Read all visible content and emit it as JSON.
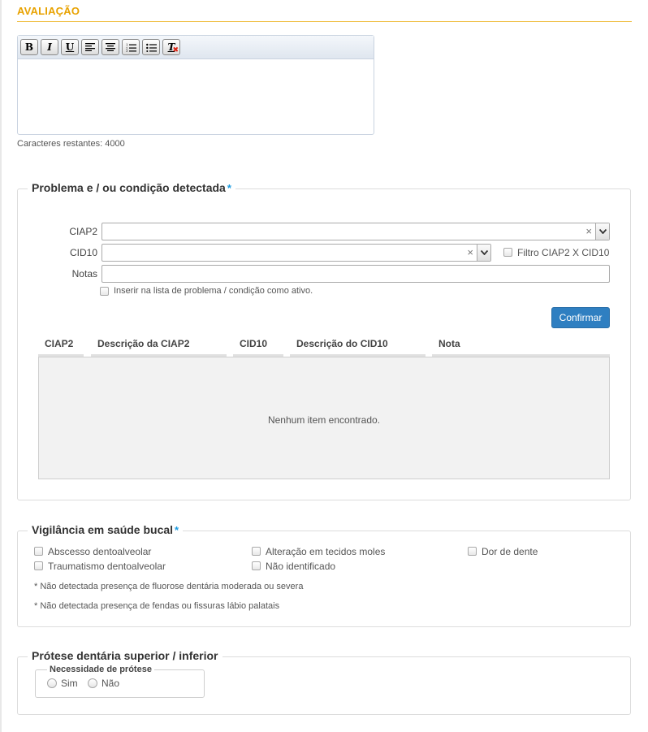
{
  "header": {
    "title": "AVALIAÇÃO"
  },
  "editor": {
    "toolbar": [
      {
        "name": "bold-button",
        "glyph": "B",
        "icon": "bold-icon"
      },
      {
        "name": "italic-button",
        "glyph": "I",
        "icon": "italic-icon"
      },
      {
        "name": "underline-button",
        "glyph": "U",
        "icon": "underline-icon"
      },
      {
        "name": "align-left-button",
        "icon": "align-left-icon"
      },
      {
        "name": "align-center-button",
        "icon": "align-center-icon"
      },
      {
        "name": "ordered-list-button",
        "icon": "ordered-list-icon"
      },
      {
        "name": "bullet-list-button",
        "icon": "bullet-list-icon"
      },
      {
        "name": "clear-format-button",
        "glyph": "T",
        "icon": "clear-format-icon"
      }
    ],
    "value": "",
    "remaining_chars": "Caracteres restantes: 4000"
  },
  "problema": {
    "legend": "Problema e / ou condição detectada",
    "required_mark": "*",
    "ciap2_label": "CIAP2",
    "cid10_label": "CID10",
    "notas_label": "Notas",
    "filtro_label": "Filtro CIAP2 X CID10",
    "inserir_label": "Inserir na lista de problema / condição como ativo.",
    "confirm_label": "Confirmar",
    "clear_glyph": "×",
    "columns": [
      "CIAP2",
      "Descrição da CIAP2",
      "CID10",
      "Descrição do CID10",
      "Nota"
    ],
    "empty_message": "Nenhum item encontrado."
  },
  "vigilancia": {
    "legend": "Vigilância em saúde bucal",
    "required_mark": "*",
    "options": [
      "Abscesso dentoalveolar",
      "Alteração em tecidos moles",
      "Dor de dente",
      "Traumatismo dentoalveolar",
      "Não identificado"
    ],
    "notes": [
      "* Não detectada presença de fluorose dentária moderada ou severa",
      "* Não detectada presença de fendas ou fissuras lábio palatais"
    ]
  },
  "protese": {
    "legend": "Prótese dentária superior / inferior",
    "necessidade_label": "Necessidade de prótese",
    "options": [
      "Sim",
      "Não"
    ]
  },
  "colors": {
    "accent": "#e8a200",
    "primary": "#2f7fc1",
    "required": "#1a9be0"
  }
}
